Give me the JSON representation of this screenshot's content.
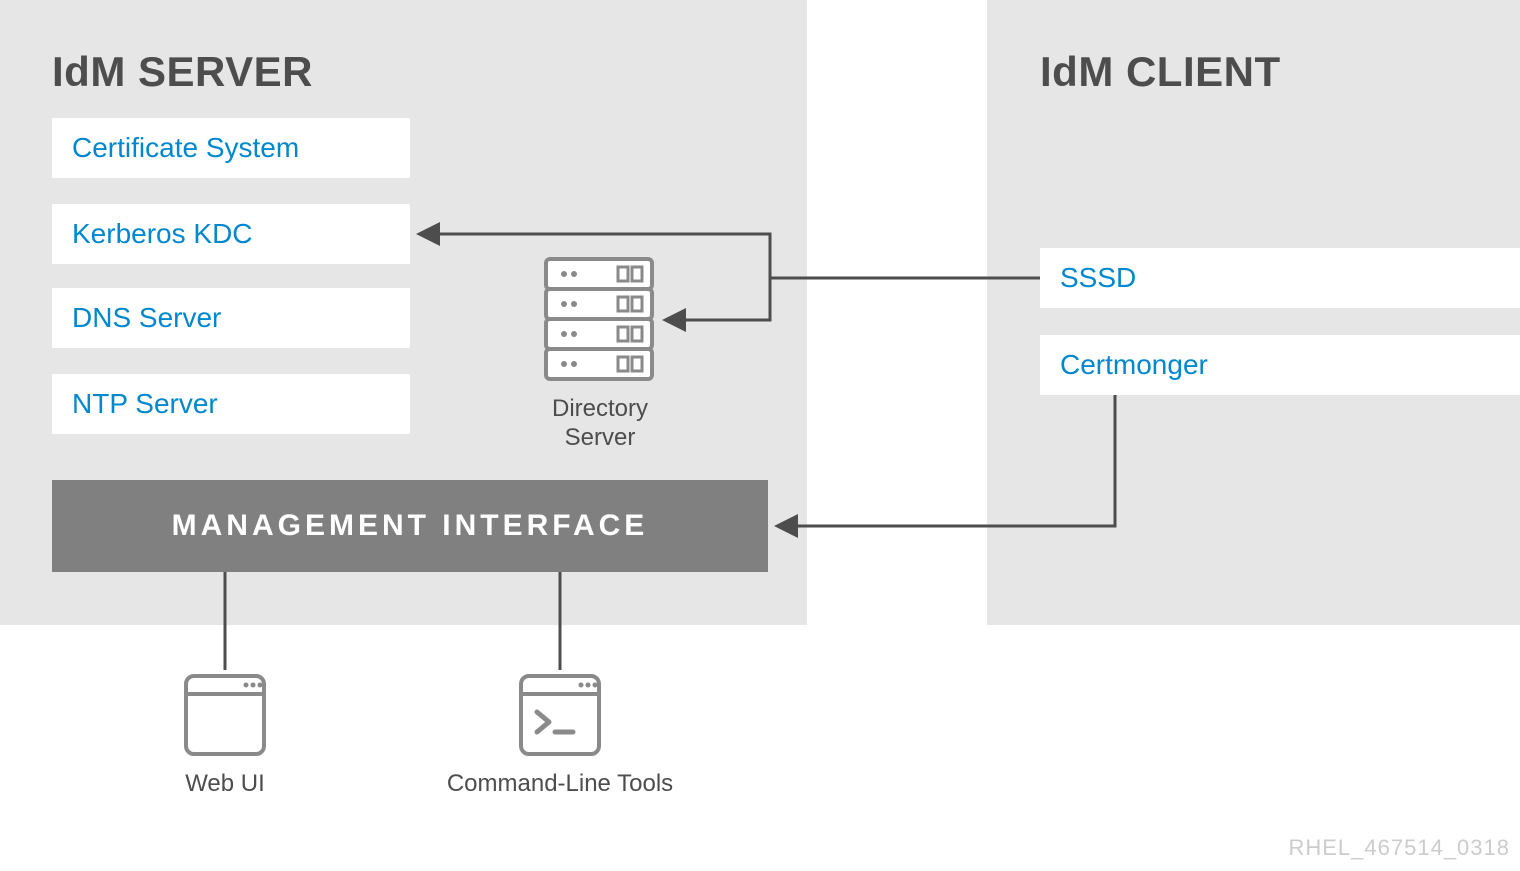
{
  "server": {
    "title": "IdM SERVER",
    "services": {
      "certificate_system": "Certificate System",
      "kerberos_kdc": "Kerberos KDC",
      "dns_server": "DNS Server",
      "ntp_server": "NTP Server"
    },
    "directory_server_label": "Directory\nServer",
    "management_interface": "MANAGEMENT INTERFACE"
  },
  "client": {
    "title": "IdM CLIENT",
    "services": {
      "sssd": "SSSD",
      "certmonger": "Certmonger"
    }
  },
  "tools": {
    "web_ui": "Web UI",
    "cli": "Command-Line Tools"
  },
  "reference_id": "RHEL_467514_0318",
  "colors": {
    "panel_bg": "#e6e6e6",
    "accent_blue": "#0088ce",
    "text_gray": "#4d4d4d",
    "mgmt_bg": "#808080",
    "ref_gray": "#cccccc",
    "line": "#4d4d4d"
  }
}
